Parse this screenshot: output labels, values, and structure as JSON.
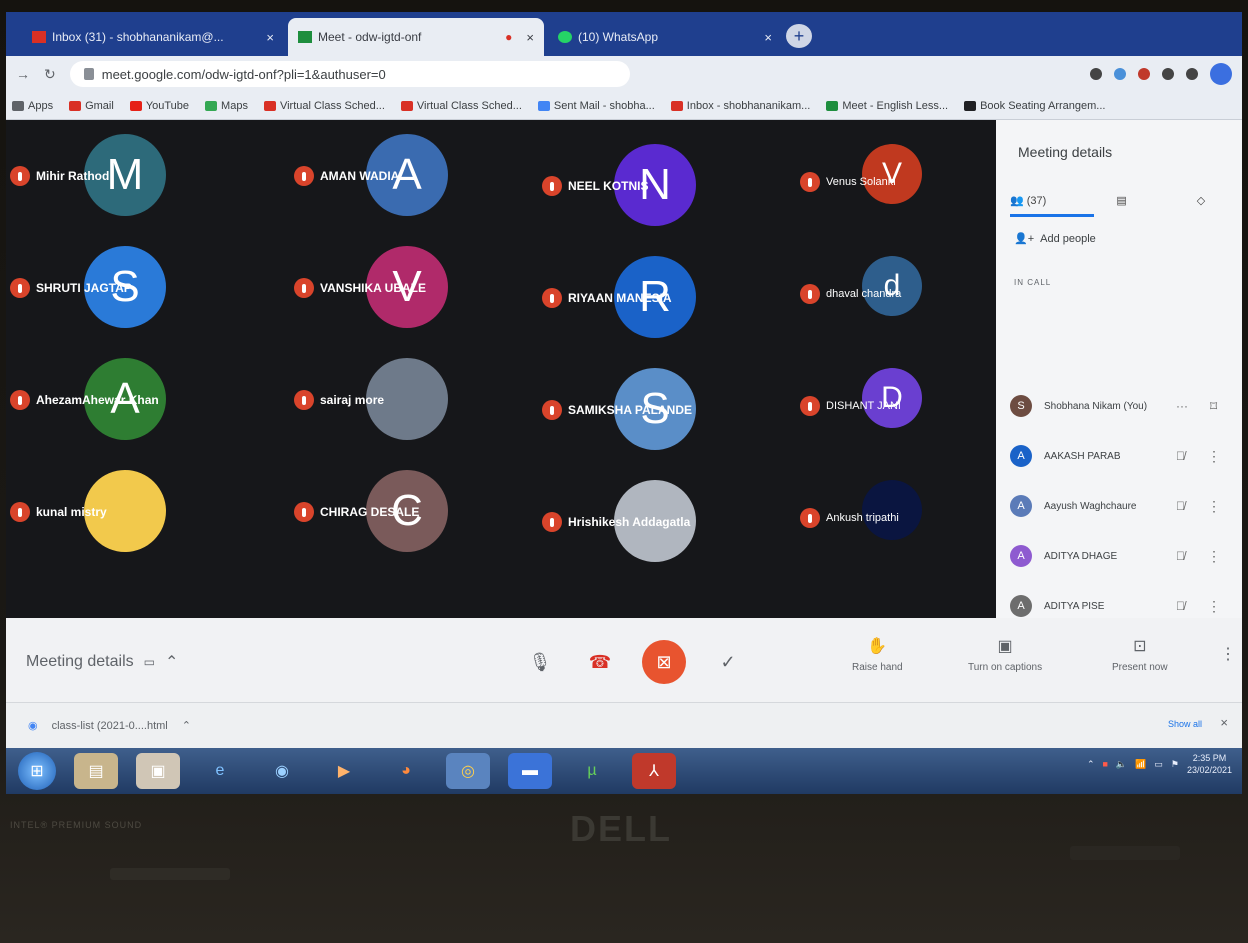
{
  "browser": {
    "tabs": [
      {
        "label": "Inbox (31) - shobhananikam@...",
        "active": false,
        "fav_color": "#d93025"
      },
      {
        "label": "Meet - odw-igtd-onf",
        "active": true,
        "fav_color": "#1e8e3e"
      },
      {
        "label": "(10) WhatsApp",
        "active": false,
        "fav_color": "#25d366"
      }
    ],
    "url": "meet.google.com/odw-igtd-onf?pli=1&authuser=0",
    "bookmarks": [
      {
        "label": "Apps",
        "color": "#5f6368"
      },
      {
        "label": "Gmail",
        "color": "#d93025"
      },
      {
        "label": "YouTube",
        "color": "#e62117"
      },
      {
        "label": "Maps",
        "color": "#34a853"
      },
      {
        "label": "Virtual Class Sched...",
        "color": "#d93025"
      },
      {
        "label": "Virtual Class Sched...",
        "color": "#d93025"
      },
      {
        "label": "Sent Mail - shobha...",
        "color": "#4285f4"
      },
      {
        "label": "Inbox - shobhananikam...",
        "color": "#d93025"
      },
      {
        "label": "Meet - English Less...",
        "color": "#1e8e3e"
      },
      {
        "label": "Book Seating Arrangem...",
        "color": "#202124"
      }
    ]
  },
  "participants": [
    {
      "name": "Mihir Rathod",
      "initial": "M",
      "color": "#2d6a7a"
    },
    {
      "name": "AMAN WADIA",
      "initial": "A",
      "color": "#3a6bb0"
    },
    {
      "name": "NEEL KOTNIS",
      "initial": "N",
      "color": "#5a2ad0"
    },
    {
      "name": "Venus Solanki",
      "initial": "V",
      "color": "#c0391f"
    },
    {
      "name": "SHRUTI JAGTAP",
      "initial": "S",
      "color": "#2a7ad8"
    },
    {
      "name": "VANSHIKA UBALE",
      "initial": "V",
      "color": "#b02a6a"
    },
    {
      "name": "RIYAAN MANESIA",
      "initial": "R",
      "color": "#1a62c8"
    },
    {
      "name": "dhaval chandra",
      "initial": "d",
      "color": "#2e5e8c"
    },
    {
      "name": "AhezamAhewar Khan",
      "initial": "A",
      "color": "#2e7d32"
    },
    {
      "name": "sairaj more",
      "initial": "",
      "color": "#6e7a8a"
    },
    {
      "name": "SAMIKSHA PALANDE",
      "initial": "S",
      "color": "#5a8ec8"
    },
    {
      "name": "DISHANT JANI",
      "initial": "D",
      "color": "#6a3fd0"
    },
    {
      "name": "kunal mistry",
      "initial": "",
      "color": "#f2c94c"
    },
    {
      "name": "CHIRAG DESALE",
      "initial": "C",
      "color": "#7a5a5a"
    },
    {
      "name": "Hrishikesh Addagatla",
      "initial": "",
      "color": "#b0b6bf"
    },
    {
      "name": "Ankush tripathi",
      "initial": "",
      "color": "#0a1540"
    }
  ],
  "panel": {
    "title": "Meeting details",
    "people_count": "(37)",
    "add_people": "Add people",
    "in_call": "IN CALL",
    "rows": [
      {
        "name": "Shobhana Nikam (You)",
        "initial": "S",
        "color": "#6d4c41"
      },
      {
        "name": "AAKASH PARAB",
        "initial": "A",
        "color": "#1a62c8"
      },
      {
        "name": "Aayush Waghchaure",
        "initial": "A",
        "color": "#5b7bb8"
      },
      {
        "name": "ADITYA DHAGE",
        "initial": "A",
        "color": "#8e5ad0"
      },
      {
        "name": "ADITYA PISE",
        "initial": "A",
        "color": "#6d6d6d"
      }
    ]
  },
  "controls": {
    "meeting_details": "Meeting details",
    "raise_hand": "Raise hand",
    "captions": "Turn on captions",
    "present": "Present now"
  },
  "downloads": {
    "file": "class-list (2021-0....html",
    "show_all": "Show all"
  },
  "taskbar": {
    "time": "2:35 PM",
    "date": "23/02/2021"
  },
  "laptop": {
    "brand": "DELL",
    "sticker": "INTEL® PREMIUM SOUND"
  }
}
